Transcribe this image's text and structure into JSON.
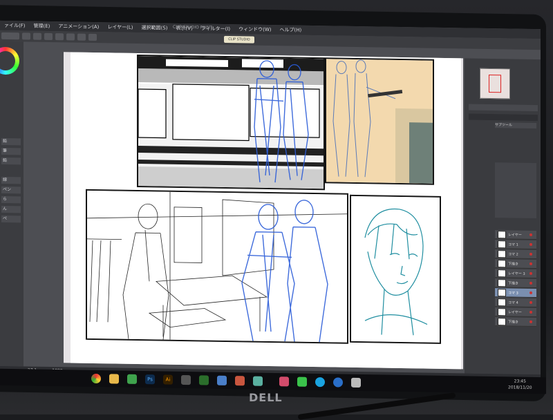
{
  "menu": {
    "items": [
      "ァイル(F)",
      "管理(E)",
      "アニメーション(A)",
      "レイヤー(L)",
      "選択範囲(S)",
      "表示(V)",
      "フィルター(I)",
      "ウィンドウ(W)",
      "ヘルプ(H)"
    ],
    "title_text": "CLIP STUDIO PAINT",
    "highlight_button": "CLIP STUDIO"
  },
  "left_panel": {
    "items": [
      "鉛",
      "筆",
      "鉛",
      "線",
      "ペン",
      "ら",
      "ん",
      "ペ"
    ]
  },
  "right_panel": {
    "subtool_label": "サブツール",
    "layers": [
      "レイヤー",
      "コマ 1",
      "コマ 2",
      "下描き",
      "レイヤー 3",
      "下描き",
      "コマ 3",
      "コマ 4",
      "レイヤー",
      "下描き"
    ]
  },
  "status": {
    "zoom": "27.1",
    "coords": "1000"
  },
  "taskbar": {
    "apps": [
      "Chrome",
      "Explorer",
      "Photos",
      "Ps",
      "Ai",
      "Calculator",
      "Xbox",
      "Maps",
      "Media",
      "Clip",
      "Paint",
      "Chat",
      "Skype",
      "Browser",
      "Notes"
    ],
    "clock_time": "23:45",
    "clock_date": "2018/11/20"
  },
  "brand": "DELL",
  "colors": {
    "accent": "#e9e3c8",
    "sketch_blue": "#2a5bd8",
    "sketch_teal": "#1f8ea0",
    "warm_panel": "#f3d9ae"
  }
}
